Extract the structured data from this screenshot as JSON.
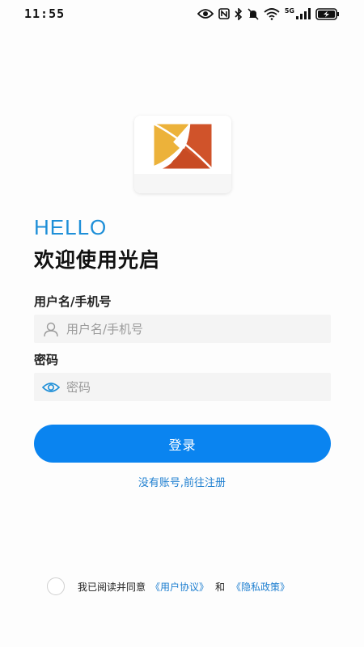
{
  "status_bar": {
    "time": "11:55",
    "network": "5G",
    "icons": [
      "eye-icon",
      "nfc-icon",
      "bluetooth-icon",
      "mute-icon",
      "wifi-icon",
      "signal-icon",
      "battery-charging-icon"
    ]
  },
  "greeting": {
    "hello": "HELLO",
    "welcome": "欢迎使用光启"
  },
  "form": {
    "username_label": "用户名/手机号",
    "username_placeholder": "用户名/手机号",
    "username_value": "",
    "password_label": "密码",
    "password_placeholder": "密码",
    "password_value": "",
    "login_button": "登录",
    "register_link": "没有账号,前往注册"
  },
  "agreement": {
    "prefix": "我已阅读并同意",
    "user_agreement": "《用户协议》",
    "conjunction": "和",
    "privacy_policy": "《隐私政策》",
    "checked": false
  },
  "colors": {
    "accent": "#0a84f0",
    "hello": "#1e8fd8",
    "link": "#1e7fd0",
    "logo_orange": "#d0532a",
    "logo_yellow": "#ecb23a"
  }
}
